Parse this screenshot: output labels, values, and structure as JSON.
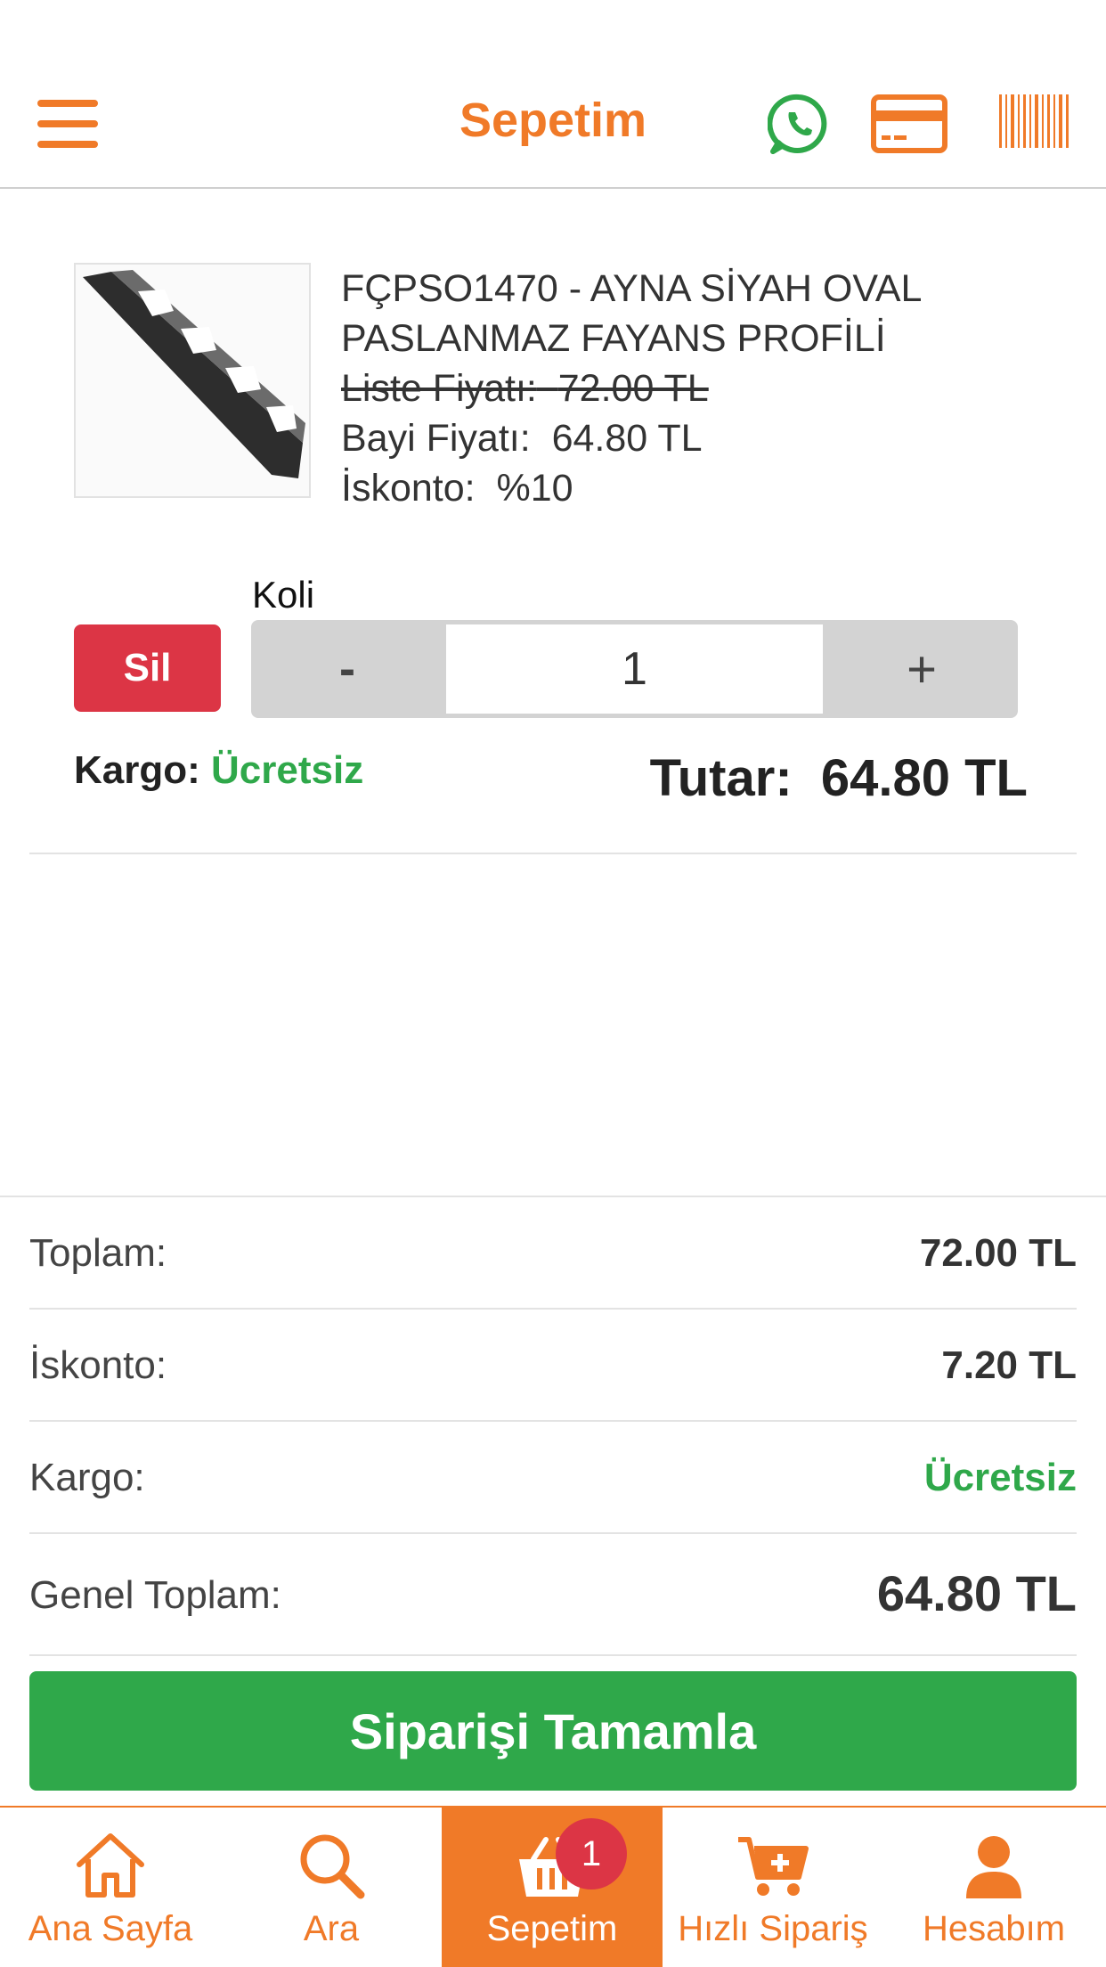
{
  "header": {
    "title": "Sepetim",
    "icons": [
      "menu-icon",
      "whatsapp-icon",
      "credit-card-icon",
      "barcode-icon"
    ]
  },
  "product": {
    "name": "FÇPSO1470 - AYNA SİYAH OVAL PASLANMAZ FAYANS PROFİLİ",
    "list_price_label": "Liste Fiyatı:",
    "list_price": "72.00 TL",
    "dealer_price_label": "Bayi Fiyatı:",
    "dealer_price": "64.80 TL",
    "discount_label": "İskonto:",
    "discount": "%10",
    "unit_label": "Koli",
    "delete_label": "Sil",
    "minus_label": "-",
    "plus_label": "+",
    "quantity": "1",
    "shipping_label": "Kargo:",
    "shipping_value": "Ücretsiz",
    "amount_label": "Tutar:",
    "amount_value": "64.80 TL"
  },
  "summary": {
    "total_label": "Toplam:",
    "total_value": "72.00 TL",
    "discount_label": "İskonto:",
    "discount_value": "7.20 TL",
    "shipping_label": "Kargo:",
    "shipping_value": "Ücretsiz",
    "grand_total_label": "Genel Toplam:",
    "grand_total_value": "64.80 TL"
  },
  "complete_button": "Siparişi Tamamla",
  "bottom_nav": {
    "items": [
      {
        "label": "Ana Sayfa",
        "icon": "home-icon"
      },
      {
        "label": "Ara",
        "icon": "search-icon"
      },
      {
        "label": "Sepetim",
        "icon": "basket-icon",
        "active": true
      },
      {
        "label": "Hızlı Sipariş",
        "icon": "cart-plus-icon"
      },
      {
        "label": "Hesabım",
        "icon": "user-icon"
      }
    ],
    "cart_badge": "1"
  },
  "colors": {
    "brand_orange": "#f07a28",
    "success_green": "#2fa84a",
    "danger_red": "#dc3545",
    "stepper_gray": "#d3d3d3"
  }
}
